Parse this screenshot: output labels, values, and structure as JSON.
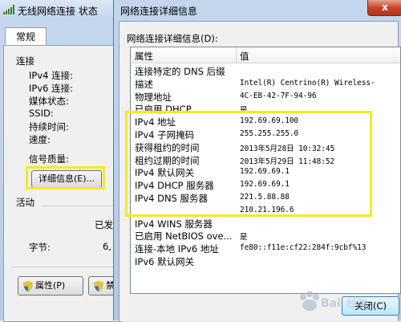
{
  "back_window": {
    "title": "无线网络连接 状态",
    "tab": "常规",
    "connection_group": "连接",
    "fields": [
      "IPv4 连接:",
      "IPv6 连接:",
      "媒体状态:",
      "SSID:",
      "持续时间:",
      "速度:"
    ],
    "signal_quality": "信号质量:",
    "details_button": "详细信息(E)...",
    "activity_group": "活动",
    "sent_label": "已发",
    "bytes_label": "字节:",
    "bytes_value": "6,",
    "properties_button": "属性(P)",
    "disable_button": "禁"
  },
  "dialog": {
    "title": "网络连接详细信息",
    "close_glyph": "x",
    "list_label": "网络连接详细信息(D):",
    "columns": {
      "property": "属性",
      "value": "值"
    },
    "rows": [
      {
        "property": "连接特定的 DNS 后缀",
        "value": ""
      },
      {
        "property": "描述",
        "value": "Intel(R) Centrino(R) Wireless-"
      },
      {
        "property": "物理地址",
        "value": "4C-EB-42-7F-94-96"
      },
      {
        "property": "已启用 DHCP",
        "value": "是"
      },
      {
        "property": "IPv4 地址",
        "value": "192.69.69.100"
      },
      {
        "property": "IPv4 子网掩码",
        "value": "255.255.255.0"
      },
      {
        "property": "获得租约的时间",
        "value": "2013年5月28日 10:32:45"
      },
      {
        "property": "租约过期的时间",
        "value": "2013年5月29日 11:48:52"
      },
      {
        "property": "IPv4 默认网关",
        "value": "192.69.69.1"
      },
      {
        "property": "IPv4 DHCP 服务器",
        "value": "192.69.69.1"
      },
      {
        "property": "IPv4 DNS 服务器",
        "value": "221.5.88.88"
      },
      {
        "property": "",
        "value": "210.21.196.6"
      },
      {
        "property": "IPv4 WINS 服务器",
        "value": ""
      },
      {
        "property": "已启用 NetBIOS ove...",
        "value": "是"
      },
      {
        "property": "连接-本地 IPv6 地址",
        "value": "fe80::f11e:cf22:284f:9cbf%13"
      },
      {
        "property": "IPv6 默认网关",
        "value": ""
      }
    ],
    "close_button": "关闭(C)"
  },
  "colors": {
    "highlight": "#f5ea1e",
    "title_bar": "#c3d6ee",
    "close_red": "#c7452a"
  },
  "watermark": "Bai 经验"
}
